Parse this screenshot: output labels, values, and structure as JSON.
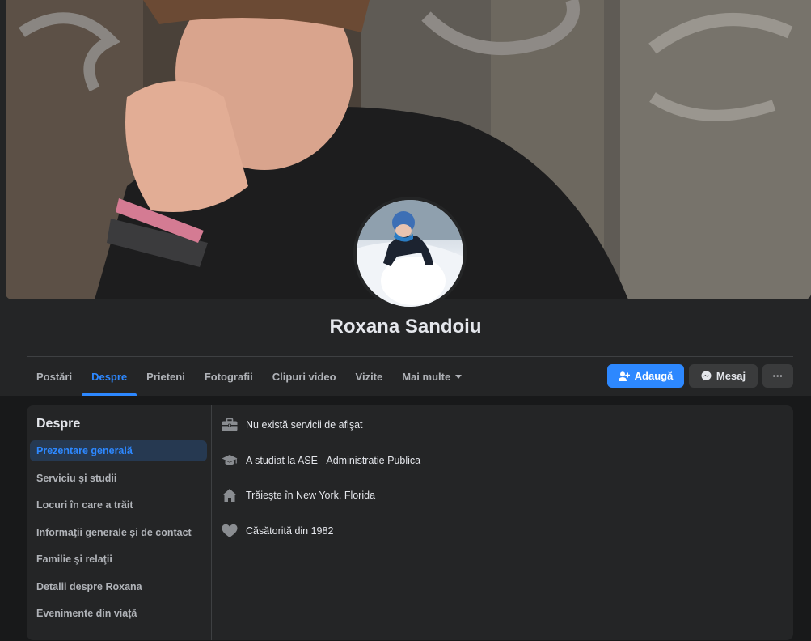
{
  "profile": {
    "name": "Roxana Sandoiu"
  },
  "tabs": [
    {
      "label": "Postări"
    },
    {
      "label": "Despre"
    },
    {
      "label": "Prieteni"
    },
    {
      "label": "Fotografii"
    },
    {
      "label": "Clipuri video"
    },
    {
      "label": "Vizite"
    },
    {
      "label": "Mai multe"
    }
  ],
  "active_tab": "Despre",
  "actions": {
    "add_label": "Adaugă",
    "message_label": "Mesaj",
    "more_label": "···"
  },
  "about": {
    "title": "Despre",
    "nav": [
      {
        "label": "Prezentare generală"
      },
      {
        "label": "Serviciu şi studii"
      },
      {
        "label": "Locuri în care a trăit"
      },
      {
        "label": "Informaţii generale şi de contact"
      },
      {
        "label": "Familie şi relaţii"
      },
      {
        "label": "Detalii despre Roxana"
      },
      {
        "label": "Evenimente din viaţă"
      }
    ],
    "active_nav": "Prezentare generală",
    "items": [
      {
        "icon": "briefcase-icon",
        "text": "Nu există servicii de afişat"
      },
      {
        "icon": "graduation-cap-icon",
        "text": "A studiat la ASE - Administratie Publica"
      },
      {
        "icon": "home-icon",
        "text": "Trăieşte în New York, Florida"
      },
      {
        "icon": "heart-icon",
        "text": "Căsătorită din 1982"
      }
    ]
  },
  "colors": {
    "accent": "#2d88ff",
    "page_bg": "#18191a",
    "card_bg": "#242526",
    "active_nav_bg": "#263951"
  }
}
